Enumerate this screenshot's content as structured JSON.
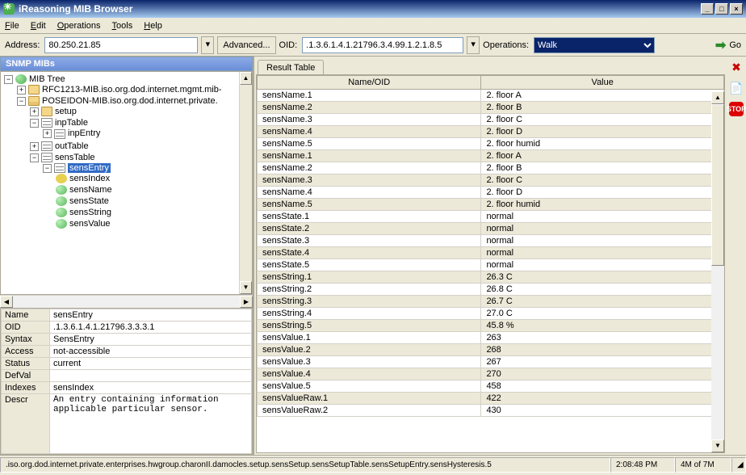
{
  "window": {
    "title": "iReasoning MIB Browser"
  },
  "menu": {
    "file": "File",
    "edit": "Edit",
    "operations": "Operations",
    "tools": "Tools",
    "help": "Help"
  },
  "toolbar": {
    "address_label": "Address:",
    "address_value": "80.250.21.85",
    "advanced": "Advanced...",
    "oid_label": "OID:",
    "oid_value": ".1.3.6.1.4.1.21796.3.4.99.1.2.1.8.5",
    "operations_label": "Operations:",
    "operation_selected": "Walk",
    "go": "Go"
  },
  "left": {
    "header": "SNMP MIBs",
    "tree": {
      "root": "MIB Tree",
      "rfc": "RFC1213-MIB.iso.org.dod.internet.mgmt.mib-",
      "poseidon": "POSEIDON-MIB.iso.org.dod.internet.private.",
      "setup": "setup",
      "inpTable": "inpTable",
      "inpEntry": "inpEntry",
      "outTable": "outTable",
      "sensTable": "sensTable",
      "sensEntry": "sensEntry",
      "sensIndex": "sensIndex",
      "sensName": "sensName",
      "sensState": "sensState",
      "sensString": "sensString",
      "sensValue": "sensValue"
    },
    "props": {
      "name_k": "Name",
      "name_v": "sensEntry",
      "oid_k": "OID",
      "oid_v": ".1.3.6.1.4.1.21796.3.3.3.1",
      "syntax_k": "Syntax",
      "syntax_v": "SensEntry",
      "access_k": "Access",
      "access_v": "not-accessible",
      "status_k": "Status",
      "status_v": "current",
      "defval_k": "DefVal",
      "defval_v": "",
      "indexes_k": "Indexes",
      "indexes_v": "sensIndex",
      "descr_k": "Descr",
      "descr_v": "An entry containing information applicable particular sensor."
    }
  },
  "right": {
    "tab": "Result Table",
    "col_name": "Name/OID",
    "col_value": "Value",
    "rows": [
      {
        "n": "sensName.1",
        "v": "2. floor A"
      },
      {
        "n": "sensName.2",
        "v": "2. floor B"
      },
      {
        "n": "sensName.3",
        "v": "2. floor C"
      },
      {
        "n": "sensName.4",
        "v": "2. floor D"
      },
      {
        "n": "sensName.5",
        "v": "2. floor humid"
      },
      {
        "n": "sensName.1",
        "v": "2. floor A"
      },
      {
        "n": "sensName.2",
        "v": "2. floor B"
      },
      {
        "n": "sensName.3",
        "v": "2. floor C"
      },
      {
        "n": "sensName.4",
        "v": "2. floor D"
      },
      {
        "n": "sensName.5",
        "v": "2. floor humid"
      },
      {
        "n": "sensState.1",
        "v": "normal"
      },
      {
        "n": "sensState.2",
        "v": "normal"
      },
      {
        "n": "sensState.3",
        "v": "normal"
      },
      {
        "n": "sensState.4",
        "v": "normal"
      },
      {
        "n": "sensState.5",
        "v": "normal"
      },
      {
        "n": "sensString.1",
        "v": "26.3 C"
      },
      {
        "n": "sensString.2",
        "v": "26.8 C"
      },
      {
        "n": "sensString.3",
        "v": "26.7 C"
      },
      {
        "n": "sensString.4",
        "v": "27.0 C"
      },
      {
        "n": "sensString.5",
        "v": "45.8 %"
      },
      {
        "n": "sensValue.1",
        "v": "263"
      },
      {
        "n": "sensValue.2",
        "v": "268"
      },
      {
        "n": "sensValue.3",
        "v": "267"
      },
      {
        "n": "sensValue.4",
        "v": "270"
      },
      {
        "n": "sensValue.5",
        "v": "458"
      },
      {
        "n": "sensValueRaw.1",
        "v": "422"
      },
      {
        "n": "sensValueRaw.2",
        "v": "430"
      }
    ]
  },
  "status": {
    "path": ".iso.org.dod.internet.private.enterprises.hwgroup.charonII.damocles.setup.sensSetup.sensSetupTable.sensSetupEntry.sensHysteresis.5",
    "time": "2:08:48 PM",
    "mem": "4M of 7M"
  }
}
